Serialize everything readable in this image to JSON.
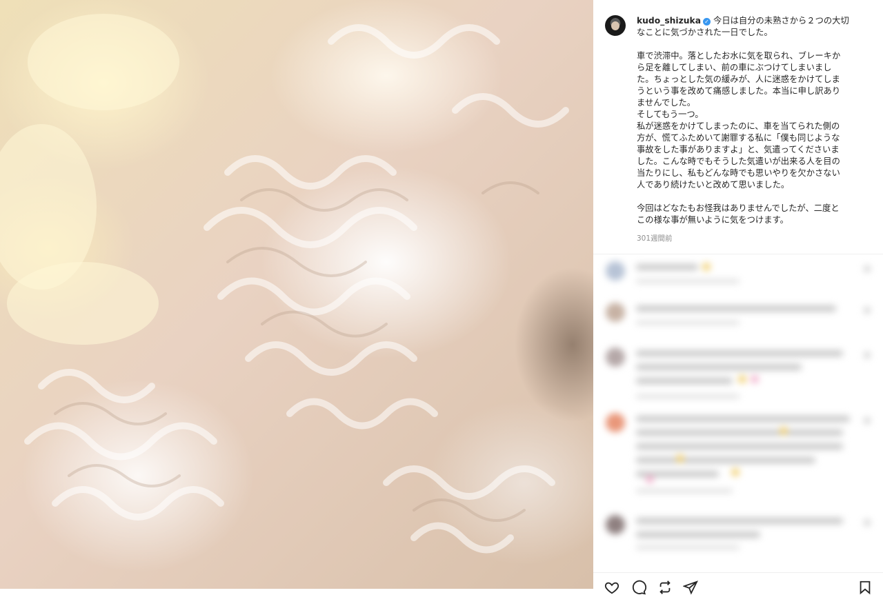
{
  "post": {
    "username": "kudo_shizuka",
    "caption_lines": [
      "今日は自分の未熟さから２つの大切",
      "なことに気づかされた一日でした。",
      "",
      "車で渋滞中。落としたお水に気を取られ、ブレーキか",
      "ら足を離してしまい、前の車にぶつけてしまいまし",
      "た。ちょっとした気の緩みが、人に迷惑をかけてしま",
      "うという事を改めて痛感しました。本当に申し訳あり",
      "ませんでした。",
      "そしてもう一つ。",
      "私が迷惑をかけてしまったのに、車を当てられた側の",
      "方が、慌てふためいて謝罪する私に「僕も同じような",
      "事故をした事がありますよ」と、気遣ってくださいま",
      "した。こんな時でもそうした気遣いが出来る人を目の",
      "当たりにし、私もどんな時でも思いやりを欠かさない",
      "人であり続けたいと改めて思いました。",
      "",
      "今回はどなたもお怪我はありませんでしたが、二度と",
      "この様な事が無いように気をつけます。"
    ],
    "timestamp": "301週間前"
  },
  "icons": {
    "verified": "verified-badge-icon",
    "like": "heart-icon",
    "comment": "comment-icon",
    "share": "repost-icon",
    "send": "send-icon",
    "save": "bookmark-icon"
  },
  "colors": {
    "verified_blue": "#3897f0",
    "text": "#262626",
    "muted": "#8e8e8e"
  }
}
